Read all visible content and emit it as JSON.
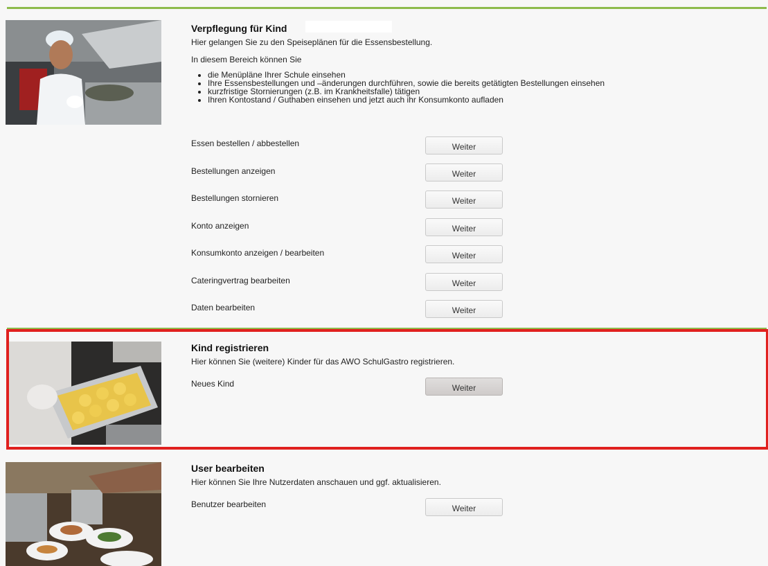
{
  "sections": [
    {
      "title": "Verpflegung für Kind",
      "description": "Hier gelangen Sie zu den Speiseplänen für die Essensbestellung.",
      "intro": "In diesem Bereich können Sie",
      "bullets": [
        "die Menüpläne Ihrer Schule einsehen",
        "Ihre Essensbestellungen und –änderungen durchführen, sowie die bereits getätigten Bestellungen einsehen",
        "kurzfristige Stornierungen (z.B. im Krankheitsfalle) tätigen",
        "Ihren Kontostand / Guthaben einsehen und jetzt auch ihr Konsumkonto aufladen"
      ],
      "rows": [
        {
          "label": "Essen bestellen / abbestellen",
          "button": "Weiter"
        },
        {
          "label": "Bestellungen anzeigen",
          "button": "Weiter"
        },
        {
          "label": "Bestellungen stornieren",
          "button": "Weiter"
        },
        {
          "label": "Konto anzeigen",
          "button": "Weiter"
        },
        {
          "label": "Konsumkonto anzeigen / bearbeiten",
          "button": "Weiter"
        },
        {
          "label": "Cateringvertrag bearbeiten",
          "button": "Weiter"
        },
        {
          "label": "Daten bearbeiten",
          "button": "Weiter"
        }
      ]
    },
    {
      "title": "Kind registrieren",
      "description": "Hier können Sie (weitere) Kinder für das AWO SchulGastro registrieren.",
      "rows": [
        {
          "label": "Neues Kind",
          "button": "Weiter"
        }
      ]
    },
    {
      "title": "User bearbeiten",
      "description": "Hier können Sie Ihre Nutzerdaten anschauen und ggf. aktualisieren.",
      "rows": [
        {
          "label": "Benutzer bearbeiten",
          "button": "Weiter"
        }
      ]
    }
  ],
  "colors": {
    "accent_green": "#8dbb4c",
    "highlight_red": "#e0201e",
    "background": "#f7f7f7"
  }
}
